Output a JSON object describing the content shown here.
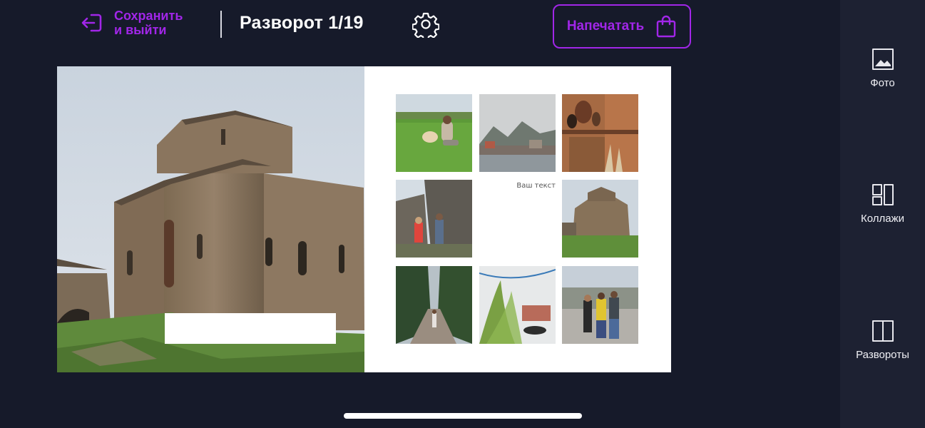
{
  "colors": {
    "background": "#161a2a",
    "sidebar": "#1d2132",
    "accent": "#a126e8",
    "text": "#ffffff"
  },
  "header": {
    "save_exit": {
      "label": "Сохранить\nи выйти",
      "icon": "exit-arrow-icon"
    },
    "spread_title": "Разворот 1/19",
    "settings_icon": "gear-icon",
    "print_button": {
      "label": "Напечатать",
      "icon": "shopping-bag-icon"
    }
  },
  "spread": {
    "left_page": {
      "photo": "church-photo"
    },
    "right_page": {
      "grid": [
        "girl-with-dog-photo",
        "mountain-town-photo",
        "pottery-shelf-photo",
        "children-by-tower-photo",
        "text-slot",
        "church-on-hill-photo",
        "cypress-alley-photo",
        "mural-wall-photo",
        "group-selfie-photo"
      ],
      "text_placeholder": "Ваш текст"
    }
  },
  "sidebar": {
    "items": [
      {
        "label": "Фото",
        "icon": "image-icon"
      },
      {
        "label": "Коллажи",
        "icon": "collage-icon"
      },
      {
        "label": "Развороты",
        "icon": "spread-icon"
      }
    ]
  }
}
